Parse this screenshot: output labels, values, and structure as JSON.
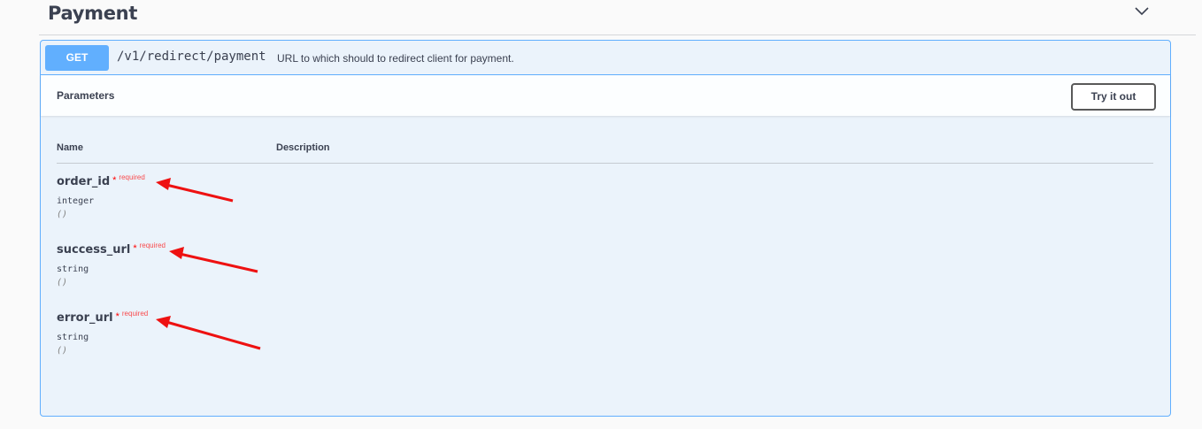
{
  "section": {
    "title": "Payment",
    "toggle_icon": "chevron-down-icon"
  },
  "operation": {
    "method": "GET",
    "path": "/v1/redirect/payment",
    "summary": "URL to which should to redirect client for payment.",
    "accent_color": "#61affe",
    "background_color": "#ebf3fb"
  },
  "parameters": {
    "title": "Parameters",
    "try_button_label": "Try it out",
    "columns": {
      "name": "Name",
      "description": "Description"
    },
    "items": [
      {
        "name": "order_id",
        "star": "*",
        "required_label": "required",
        "type": "integer",
        "in": "()"
      },
      {
        "name": "success_url",
        "star": "*",
        "required_label": "required",
        "type": "string",
        "in": "()"
      },
      {
        "name": "error_url",
        "star": "*",
        "required_label": "required",
        "type": "string",
        "in": "()"
      }
    ]
  },
  "annotations": {
    "arrow_color": "#ff0000",
    "arrow_icon": "red-arrow-annotation"
  }
}
